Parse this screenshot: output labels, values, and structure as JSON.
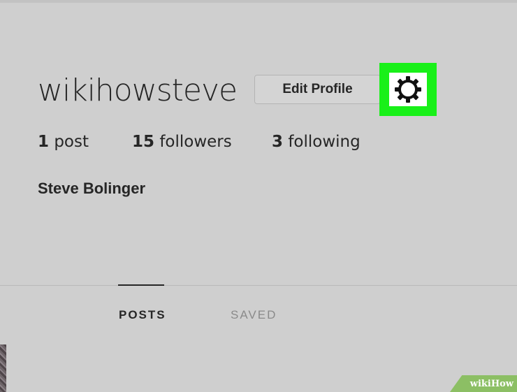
{
  "profile": {
    "username": "wikihowsteve",
    "edit_profile_label": "Edit Profile",
    "settings_icon": "gear-icon",
    "full_name": "Steve Bolinger"
  },
  "stats": {
    "posts_count": "1",
    "posts_label": "post",
    "followers_count": "15",
    "followers_label": "followers",
    "following_count": "3",
    "following_label": "following"
  },
  "tabs": [
    {
      "label": "POSTS",
      "active": true
    },
    {
      "label": "SAVED",
      "active": false
    }
  ],
  "colors": {
    "highlight": "#19f019",
    "background": "#cfcfcf",
    "text": "#262626",
    "inactive_tab": "#8a8a8a"
  },
  "watermark": {
    "wiki": "wiki",
    "how": "How"
  }
}
